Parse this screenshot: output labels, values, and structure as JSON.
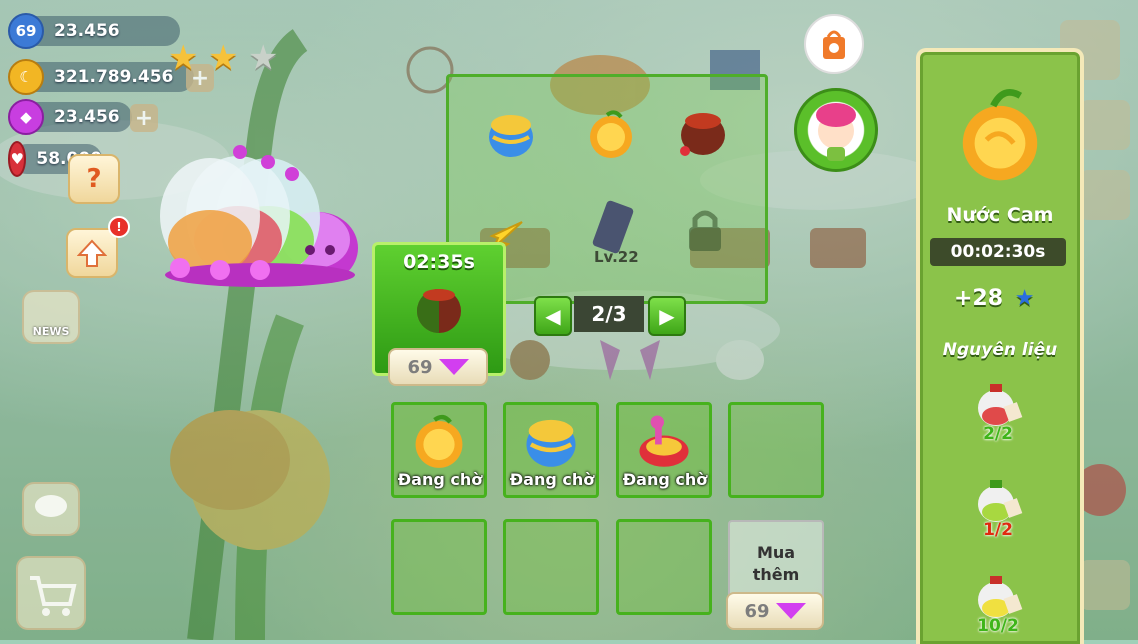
{
  "hud": {
    "level": "69",
    "stars_value": "23.456",
    "coins_value": "321.789.456",
    "gems_value": "23.456",
    "hearts_value": "58.000",
    "stars_earned": 2,
    "stars_total": 3
  },
  "left_buttons": {
    "help_label": "?",
    "news_label": "NEWS"
  },
  "recipe_grid": {
    "level_label": "Lv.22",
    "page_label": "2/3",
    "prev_symbol": "◀",
    "next_symbol": "▶"
  },
  "active_slot": {
    "timer": "02:35s",
    "speedup_cost": "69"
  },
  "queue": {
    "items": [
      {
        "status": "Đang chờ",
        "icon": "orange-juice-icon"
      },
      {
        "status": "Đang chờ",
        "icon": "blue-jar-icon"
      },
      {
        "status": "Đang chờ",
        "icon": "red-potion-icon"
      }
    ],
    "buy_more_label_1": "Mua",
    "buy_more_label_2": "thêm",
    "buy_more_cost": "69"
  },
  "product_panel": {
    "name": "Nước Cam",
    "timer": "00:02:30s",
    "xp_reward": "+28",
    "ingredients_title": "Nguyên liệu",
    "ingredients": [
      {
        "count": "2/2",
        "color": "#3fb51a",
        "icon": "strawberry-jar-icon"
      },
      {
        "count": "1/2",
        "color": "#e02a10",
        "icon": "lime-jar-icon"
      },
      {
        "count": "10/2",
        "color": "#3fb51a",
        "icon": "lemon-jar-icon"
      }
    ]
  },
  "colors": {
    "accent_green": "#4fae2a",
    "gem_pink": "#d23ef0",
    "panel_green": "#8bc34a"
  }
}
